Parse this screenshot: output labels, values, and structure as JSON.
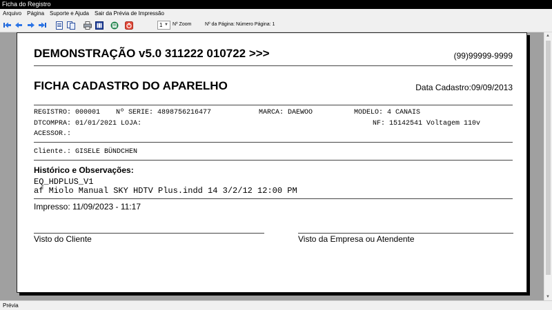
{
  "window": {
    "title": "Ficha do Registro"
  },
  "menu": [
    {
      "label": "Arquivo"
    },
    {
      "label": "Página"
    },
    {
      "label": "Suporte e Ajuda"
    },
    {
      "label": "Sair da Prévia de Impressão"
    }
  ],
  "toolbar": {
    "zoom_value": "1",
    "zoom_label": "Nº Zoom",
    "page_label": "Nº da Página: Número Página: 1",
    "icons": [
      "first-page-icon",
      "prev-page-icon",
      "next-page-icon",
      "last-page-icon",
      "single-page-icon",
      "two-pages-icon",
      "print-icon",
      "grid-icon",
      "export-icon",
      "close-preview-icon"
    ]
  },
  "document": {
    "company": "DEMONSTRAÇÃO v5.0 311222 010722 >>>",
    "phone": "(99)99999-9999",
    "form_title": "FICHA CADASTRO DO APARELHO",
    "date_registered": "Data Cadastro:09/09/2013",
    "registro": "REGISTRO: 000001",
    "serie": "Nº SERIE: 4898756216477",
    "marca": "MARCA: DAEWOO",
    "modelo": "MODELO: 4 CANAIS",
    "dtcompra": "DTCOMPRA: 01/01/2021 LOJA:",
    "nf": "NF: 15142541 Voltagem 110v",
    "acessor": "ACESSOR.:",
    "cliente": "Cliente.: GISELE BÜNDCHEN",
    "history_title": "Histórico e Observações:",
    "history_lines": [
      "EQ_HDPLUS_V1",
      "af Miolo Manual SKY HDTV Plus.indd 14 3/2/12 12:00 PM"
    ],
    "printed": "Impresso: 11/09/2023 - 11:17",
    "sig_client": "Visto do Cliente",
    "sig_company": "Visto da Empresa ou Atendente"
  },
  "status": {
    "text": "Prévia"
  }
}
